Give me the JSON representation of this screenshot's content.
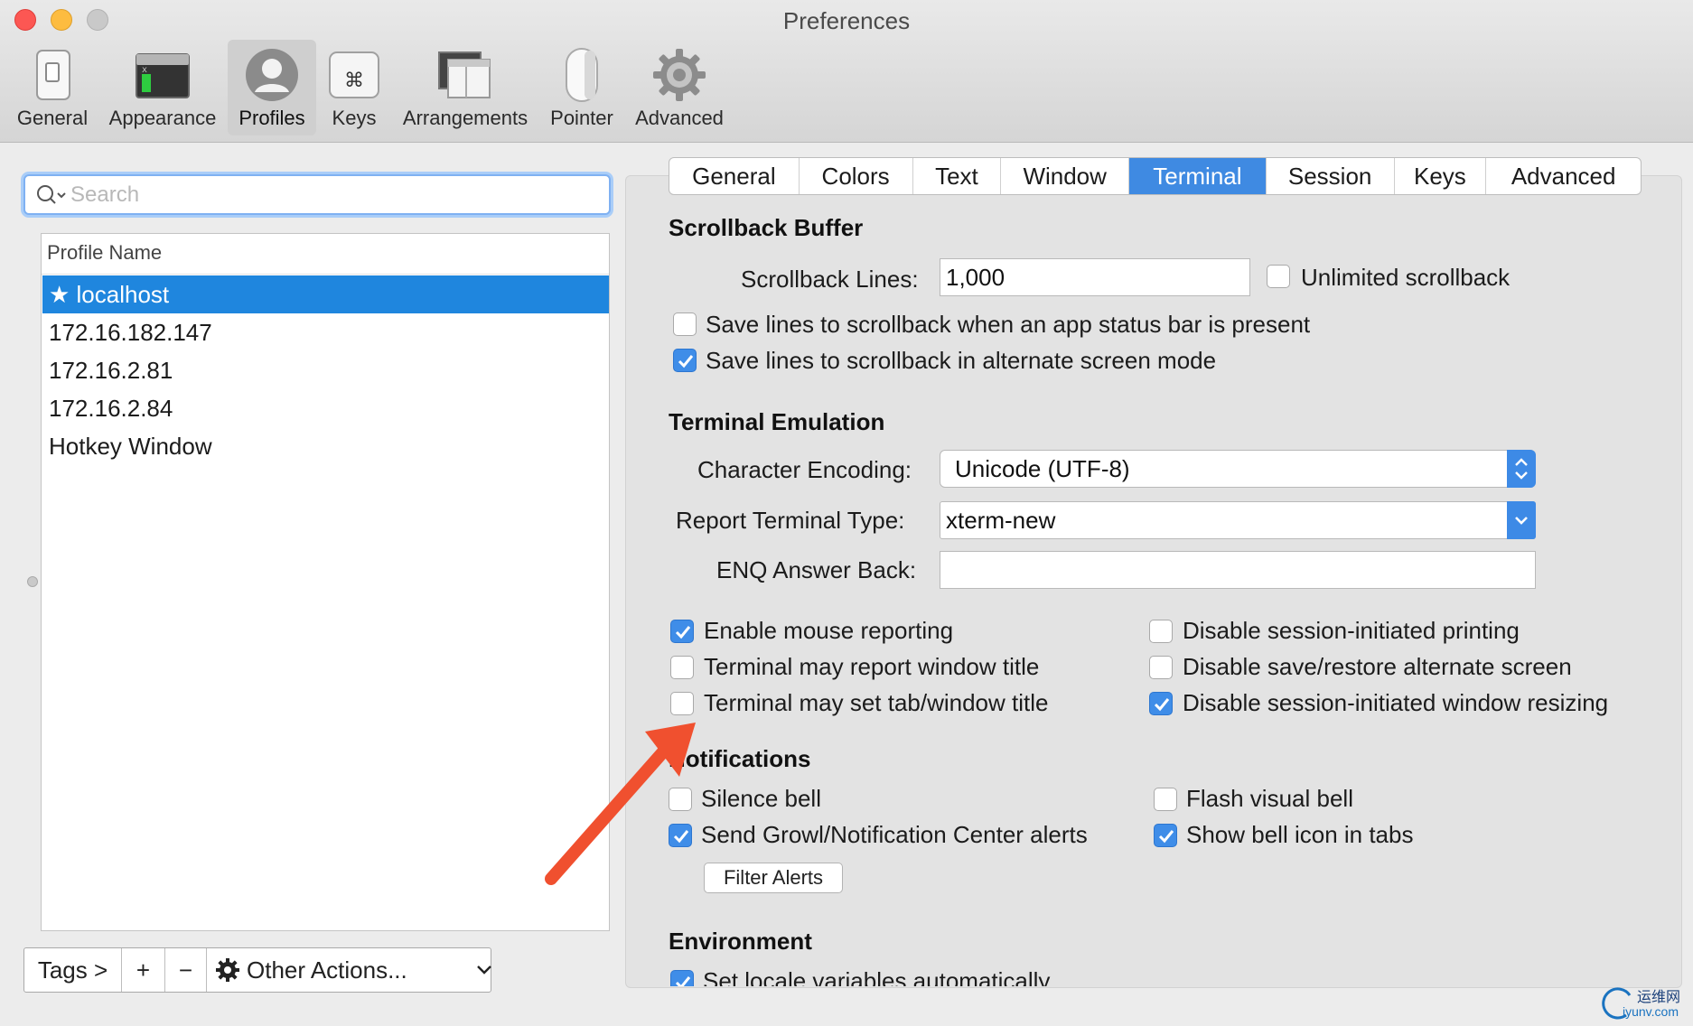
{
  "window": {
    "title": "Preferences"
  },
  "toolbar": {
    "items": [
      {
        "label": "General",
        "icon": "switch-icon"
      },
      {
        "label": "Appearance",
        "icon": "window-icon"
      },
      {
        "label": "Profiles",
        "icon": "user-icon",
        "active": true
      },
      {
        "label": "Keys",
        "icon": "command-key-icon"
      },
      {
        "label": "Arrangements",
        "icon": "windows-icon"
      },
      {
        "label": "Pointer",
        "icon": "mouse-icon"
      },
      {
        "label": "Advanced",
        "icon": "gear-icon"
      }
    ]
  },
  "search": {
    "placeholder": "Search",
    "value": ""
  },
  "profiles": {
    "header": "Profile Name",
    "items": [
      "★ localhost",
      "172.16.182.147",
      "172.16.2.81",
      "172.16.2.84",
      "Hotkey Window"
    ],
    "selected_index": 0
  },
  "bottom_bar": {
    "tags": "Tags >",
    "add": "+",
    "remove": "−",
    "other_actions": "Other Actions..."
  },
  "tabs": {
    "items": [
      "General",
      "Colors",
      "Text",
      "Window",
      "Terminal",
      "Session",
      "Keys",
      "Advanced"
    ],
    "active": "Terminal"
  },
  "scrollback": {
    "title": "Scrollback Buffer",
    "lines_label": "Scrollback Lines:",
    "lines_value": "1,000",
    "unlimited": {
      "label": "Unlimited scrollback",
      "checked": false
    },
    "save_status_bar": {
      "label": "Save lines to scrollback when an app status bar is present",
      "checked": false
    },
    "save_alternate": {
      "label": "Save lines to scrollback in alternate screen mode",
      "checked": true
    }
  },
  "emulation": {
    "title": "Terminal Emulation",
    "encoding_label": "Character Encoding:",
    "encoding_value": "Unicode (UTF-8)",
    "type_label": "Report Terminal Type:",
    "type_value": "xterm-new",
    "enq_label": "ENQ Answer Back:",
    "enq_value": "",
    "checkboxes": {
      "mouse_reporting": {
        "label": "Enable mouse reporting",
        "checked": true
      },
      "report_title": {
        "label": "Terminal may report window title",
        "checked": false
      },
      "set_title": {
        "label": "Terminal may set tab/window title",
        "checked": false
      },
      "disable_printing": {
        "label": "Disable session-initiated printing",
        "checked": false
      },
      "disable_save_restore": {
        "label": "Disable save/restore alternate screen",
        "checked": false
      },
      "disable_resizing": {
        "label": "Disable session-initiated window resizing",
        "checked": true
      }
    }
  },
  "notifications": {
    "title": "Notifications",
    "silence_bell": {
      "label": "Silence bell",
      "checked": false
    },
    "growl": {
      "label": "Send Growl/Notification Center alerts",
      "checked": true
    },
    "flash_bell": {
      "label": "Flash visual bell",
      "checked": false
    },
    "bell_icon": {
      "label": "Show bell icon in tabs",
      "checked": true
    },
    "filter_button": "Filter Alerts"
  },
  "environment": {
    "title": "Environment",
    "set_locale": {
      "label": "Set locale variables automatically",
      "checked": true
    }
  },
  "watermark": {
    "cn": "运维网",
    "en": "iyunv.com"
  },
  "colors": {
    "accent": "#3f8ae2",
    "selection": "#1f86de",
    "annotation_arrow": "#f0502f"
  }
}
